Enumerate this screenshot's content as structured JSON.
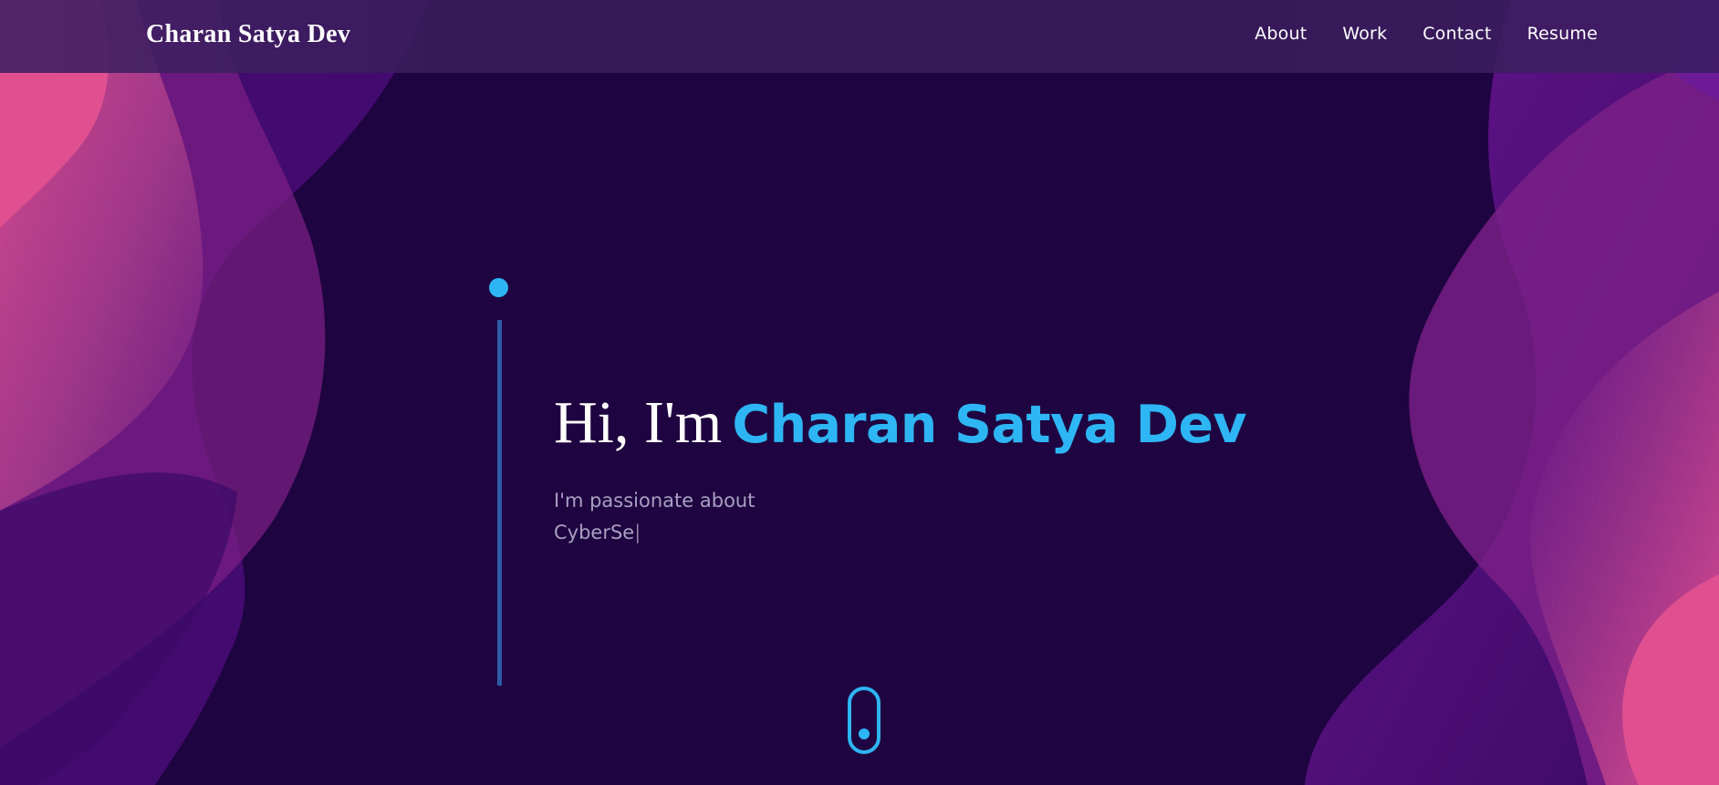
{
  "nav": {
    "brand": "Charan Satya Dev",
    "links": [
      "About",
      "Work",
      "Contact",
      "Resume"
    ]
  },
  "hero": {
    "greeting": "Hi, I'm",
    "name": "Charan Satya Dev",
    "subtitle_line1": "I'm passionate about",
    "subtitle_line2": "CyberSe",
    "caret": "|"
  },
  "icons": {
    "scroll": "scroll-down-mouse-icon"
  },
  "colors": {
    "background": "#1e0440",
    "accent": "#2eb5f3",
    "timeline_line": "#2d5ba6",
    "subtitle": "#a8a0c2",
    "navbar": "#3a1c5c"
  }
}
